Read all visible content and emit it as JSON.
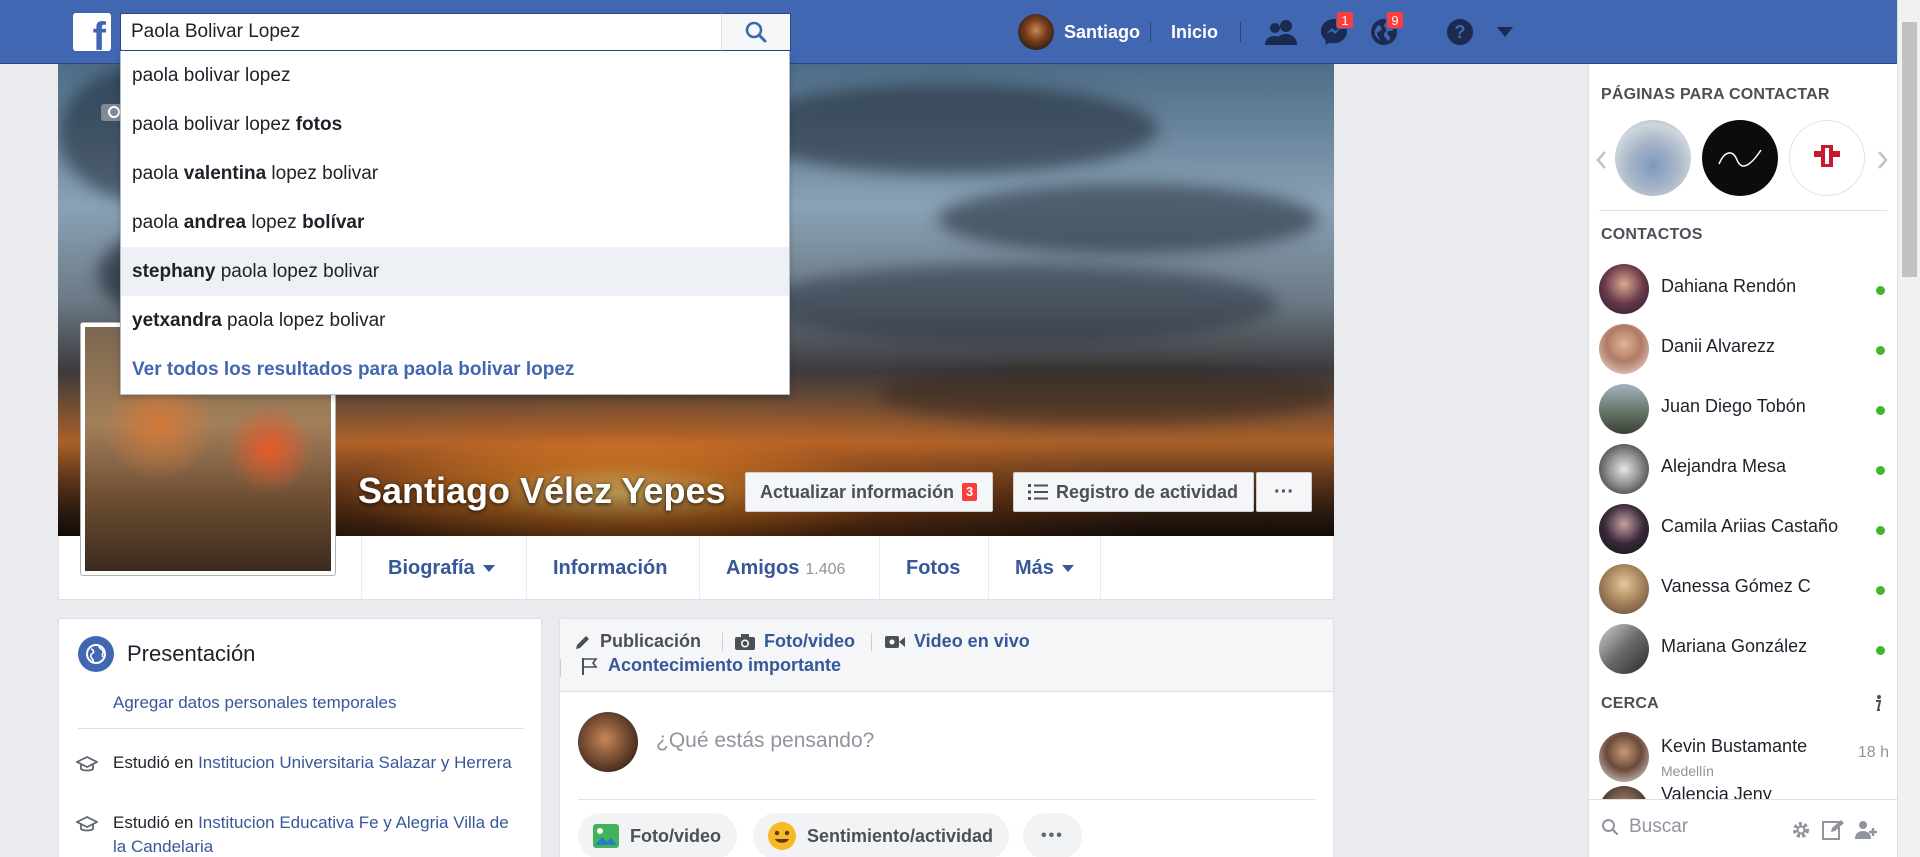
{
  "topbar": {
    "logo_letter": "f",
    "search_value": "Paola Bolivar Lopez",
    "profile_name": "Santiago",
    "home_label": "Inicio",
    "messages_badge": "1",
    "notifications_badge": "9"
  },
  "dropdown": {
    "suggestions": [
      {
        "pre": "paola bolivar lopez",
        "b1": "",
        "mid": "",
        "b2": ""
      },
      {
        "pre": "paola bolivar lopez ",
        "b1": "fotos",
        "mid": "",
        "b2": ""
      },
      {
        "pre": "paola ",
        "b1": "valentina",
        "mid": " lopez bolivar",
        "b2": ""
      },
      {
        "pre": "paola ",
        "b1": "andrea",
        "mid": " lopez ",
        "b2": "bolívar"
      },
      {
        "pre": "",
        "b1": "stephany",
        "mid": " paola lopez bolivar",
        "b2": ""
      },
      {
        "pre": "",
        "b1": "yetxandra",
        "mid": " paola lopez bolivar",
        "b2": ""
      }
    ],
    "see_all": "Ver todos los resultados para paola bolivar lopez"
  },
  "profile": {
    "name": "Santiago Vélez Yepes",
    "update_info_label": "Actualizar información",
    "update_info_badge": "3",
    "activity_log_label": "Registro de actividad",
    "more_dots": "···"
  },
  "nav": {
    "tabs": [
      "Biografía",
      "Información",
      "Amigos",
      "Fotos",
      "Más"
    ],
    "friends_count": "1.406"
  },
  "intro": {
    "title": "Presentación",
    "add_temp_link": "Agregar datos personales temporales",
    "studied_prefix": "Estudió en",
    "school1": "Institucion Universitaria Salazar y Herrera",
    "school2": "Institucion Educativa Fe y Alegria Villa de la Candelaria"
  },
  "composer": {
    "tab_publication": "Publicación",
    "tab_photo_video": "Foto/video",
    "tab_live_video": "Video en vivo",
    "tab_life_event": "Acontecimiento importante",
    "placeholder": "¿Qué estás pensando?",
    "pill_photo": "Foto/video",
    "pill_feeling": "Sentimiento/actividad",
    "pill_more": "•••"
  },
  "sidebar": {
    "pages_title": "PÁGINAS PARA CONTACTAR",
    "contacts_title": "CONTACTOS",
    "contacts": [
      {
        "name": "Dahiana Rendón",
        "online": true
      },
      {
        "name": "Danii Alvarezz",
        "online": true
      },
      {
        "name": "Juan Diego Tobón",
        "online": true
      },
      {
        "name": "Alejandra Mesa",
        "online": true
      },
      {
        "name": "Camila Ariias Castaño",
        "online": true
      },
      {
        "name": "Vanessa Gómez C",
        "online": true
      },
      {
        "name": "Mariana González",
        "online": true
      }
    ],
    "nearby_title": "CERCA",
    "nearby_name": "Kevin Bustamante",
    "nearby_city": "Medellín",
    "nearby_time": "18 h",
    "nearby_next": "Valencia Jeny",
    "search_placeholder": "Buscar"
  },
  "colors": {
    "brand": "#4267b2",
    "link": "#365899",
    "online": "#42b72a",
    "badge": "#fa3e3e"
  },
  "icons": [
    "search-icon",
    "friend-requests-icon",
    "messenger-icon",
    "globe-icon",
    "help-icon",
    "caret-down-icon",
    "camera-icon",
    "list-icon",
    "pencil-icon",
    "flag-icon",
    "video-icon",
    "photo-icon",
    "emoji-icon",
    "gear-icon",
    "compose-icon",
    "group-icon",
    "info-icon"
  ]
}
